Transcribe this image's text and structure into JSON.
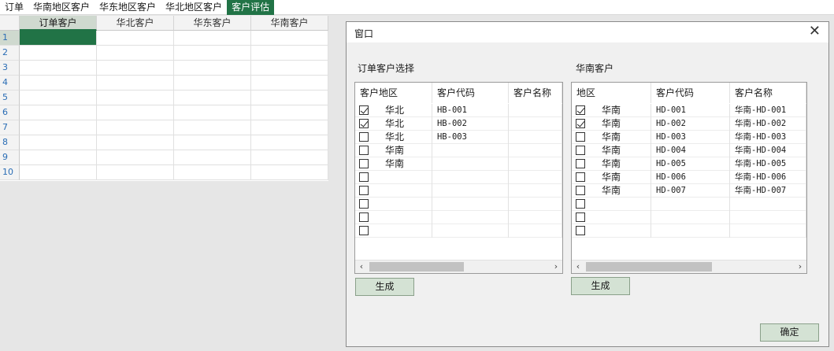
{
  "tabs": [
    {
      "label": "订单",
      "active": false
    },
    {
      "label": "华南地区客户",
      "active": false
    },
    {
      "label": "华东地区客户",
      "active": false
    },
    {
      "label": "华北地区客户",
      "active": false
    },
    {
      "label": "客户评估",
      "active": true
    }
  ],
  "sheet": {
    "columns": [
      "订单客户",
      "华北客户",
      "华东客户",
      "华南客户"
    ],
    "row_numbers": [
      "1",
      "2",
      "3",
      "4",
      "5",
      "6",
      "7",
      "8",
      "9",
      "10"
    ],
    "selected_cell": "A1"
  },
  "dialog": {
    "title": "窗口",
    "close_glyph": "✕",
    "left_panel": {
      "label": "订单客户选择",
      "headers": [
        "客户地区",
        "客户代码",
        "客户名称"
      ],
      "rows": [
        {
          "checked": true,
          "region": "华北",
          "code": "HB-001",
          "name": ""
        },
        {
          "checked": true,
          "region": "华北",
          "code": "HB-002",
          "name": ""
        },
        {
          "checked": false,
          "region": "华北",
          "code": "HB-003",
          "name": ""
        },
        {
          "checked": false,
          "region": "华南",
          "code": "",
          "name": ""
        },
        {
          "checked": false,
          "region": "华南",
          "code": "",
          "name": ""
        },
        {
          "checked": false,
          "region": "",
          "code": "",
          "name": ""
        },
        {
          "checked": false,
          "region": "",
          "code": "",
          "name": ""
        },
        {
          "checked": false,
          "region": "",
          "code": "",
          "name": ""
        },
        {
          "checked": false,
          "region": "",
          "code": "",
          "name": ""
        },
        {
          "checked": false,
          "region": "",
          "code": "",
          "name": ""
        }
      ],
      "generate_label": "生成"
    },
    "right_panel": {
      "label": "华南客户",
      "headers": [
        "地区",
        "客户代码",
        "客户名称"
      ],
      "rows": [
        {
          "checked": true,
          "region": "华南",
          "code": "HD-001",
          "name": "华南-HD-001"
        },
        {
          "checked": true,
          "region": "华南",
          "code": "HD-002",
          "name": "华南-HD-002"
        },
        {
          "checked": false,
          "region": "华南",
          "code": "HD-003",
          "name": "华南-HD-003"
        },
        {
          "checked": false,
          "region": "华南",
          "code": "HD-004",
          "name": "华南-HD-004"
        },
        {
          "checked": false,
          "region": "华南",
          "code": "HD-005",
          "name": "华南-HD-005"
        },
        {
          "checked": false,
          "region": "华南",
          "code": "HD-006",
          "name": "华南-HD-006"
        },
        {
          "checked": false,
          "region": "华南",
          "code": "HD-007",
          "name": "华南-HD-007"
        },
        {
          "checked": false,
          "region": "",
          "code": "",
          "name": ""
        },
        {
          "checked": false,
          "region": "",
          "code": "",
          "name": ""
        },
        {
          "checked": false,
          "region": "",
          "code": "",
          "name": ""
        }
      ],
      "generate_label": "生成"
    },
    "scroll_left_glyph": "‹",
    "scroll_right_glyph": "›",
    "ok_label": "确定"
  },
  "colors": {
    "accent": "#217346",
    "button_bg": "#d4e2d4"
  }
}
